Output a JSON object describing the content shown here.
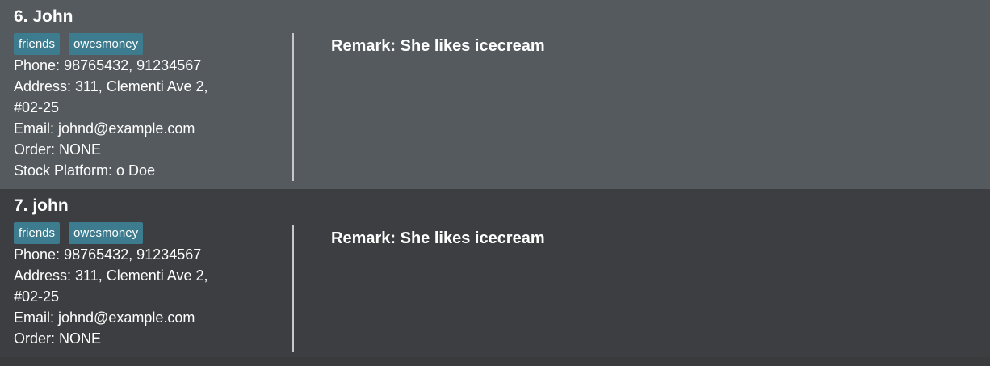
{
  "persons": [
    {
      "index_name": "6. John",
      "tags": [
        "friends",
        "owesmoney"
      ],
      "fields": [
        {
          "label": "Phone:",
          "value": "98765432, 91234567"
        },
        {
          "label": "Address:",
          "value": "311, Clementi Ave 2,"
        },
        {
          "label": "",
          "value": "#02-25"
        },
        {
          "label": "Email:",
          "value": "johnd@example.com"
        },
        {
          "label": "Order:",
          "value": "NONE"
        },
        {
          "label": "Stock Platform:",
          "value": "o Doe"
        }
      ],
      "remark_label": "Remark:",
      "remark": "She likes icecream"
    },
    {
      "index_name": "7. john",
      "tags": [
        "friends",
        "owesmoney"
      ],
      "fields": [
        {
          "label": "Phone:",
          "value": "98765432, 91234567"
        },
        {
          "label": "Address:",
          "value": "311, Clementi Ave 2,"
        },
        {
          "label": "",
          "value": "#02-25"
        },
        {
          "label": "Email:",
          "value": "johnd@example.com"
        },
        {
          "label": "Order:",
          "value": "NONE"
        }
      ],
      "remark_label": "Remark:",
      "remark": "She likes icecream"
    }
  ],
  "colors": {
    "card_selected_bg": "#545a5e",
    "card_bg": "#3d3e41",
    "tag_bg": "#3d7b8f",
    "divider": "#c8c8c8"
  }
}
